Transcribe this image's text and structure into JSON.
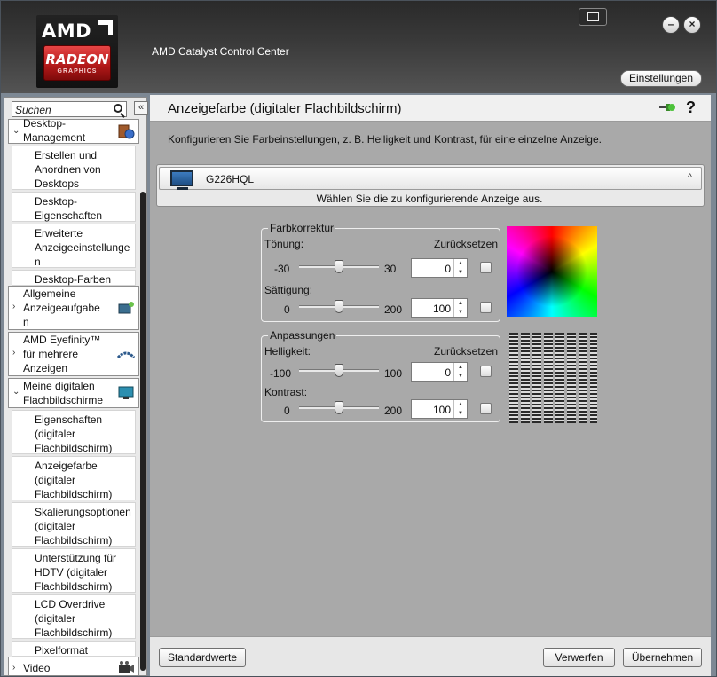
{
  "app": {
    "title": "AMD Catalyst Control Center",
    "logo_text_top": "AMD",
    "logo_text_mid": "RADEON",
    "logo_text_bottom": "GRAPHICS",
    "settings_label": "Einstellungen",
    "minimize_label": "–",
    "close_label": "×"
  },
  "sidebar": {
    "search_placeholder": "Suchen",
    "collapse_label": "«",
    "categories": [
      {
        "label": "Desktop-\nManagement",
        "chevron": "⌄"
      },
      {
        "label": "Allgemeine\nAnzeigeaufgabe\nn",
        "chevron": "›"
      },
      {
        "label": "AMD Eyefinity™\nfür mehrere\nAnzeigen",
        "chevron": "›"
      },
      {
        "label": "Meine digitalen\nFlachbildschirme",
        "chevron": "⌄"
      },
      {
        "label": "Video",
        "chevron": "›"
      }
    ],
    "items": [
      {
        "label": "Erstellen und\nAnordnen von\nDesktops"
      },
      {
        "label": "Desktop-\nEigenschaften"
      },
      {
        "label": "Erweiterte\nAnzeigeeinstellunge\nn"
      },
      {
        "label": "Desktop-Farben"
      },
      {
        "label": "Eigenschaften\n(digitaler\nFlachbildschirm)"
      },
      {
        "label": "Anzeigefarbe\n(digitaler\nFlachbildschirm)"
      },
      {
        "label": "Skalierungsoptionen\n(digitaler\nFlachbildschirm)"
      },
      {
        "label": "Unterstützung für\nHDTV (digitaler\nFlachbildschirm)"
      },
      {
        "label": "LCD Overdrive\n(digitaler\nFlachbildschirm)"
      },
      {
        "label": "Pixelformat"
      }
    ]
  },
  "main": {
    "title": "Anzeigefarbe (digitaler Flachbildschirm)",
    "help_label": "?",
    "description": "Konfigurieren Sie Farbeinstellungen, z. B. Helligkeit und Kontrast, für eine einzelne Anzeige.",
    "display": {
      "name": "G226HQL",
      "chevron": "^",
      "hint": "Wählen Sie die zu konfigurierende Anzeige aus."
    },
    "color_correction": {
      "title": "Farbkorrektur",
      "reset_label": "Zurücksetzen",
      "hue": {
        "label": "Tönung:",
        "min": "-30",
        "max": "30",
        "value": "0",
        "fraction": 0.5
      },
      "saturation": {
        "label": "Sättigung:",
        "min": "0",
        "max": "200",
        "value": "100",
        "fraction": 0.5
      }
    },
    "adjustments": {
      "title": "Anpassungen",
      "reset_label": "Zurücksetzen",
      "brightness": {
        "label": "Helligkeit:",
        "min": "-100",
        "max": "100",
        "value": "0",
        "fraction": 0.5
      },
      "contrast": {
        "label": "Kontrast:",
        "min": "0",
        "max": "200",
        "value": "100",
        "fraction": 0.5
      }
    }
  },
  "footer": {
    "defaults_label": "Standardwerte",
    "discard_label": "Verwerfen",
    "apply_label": "Übernehmen"
  }
}
